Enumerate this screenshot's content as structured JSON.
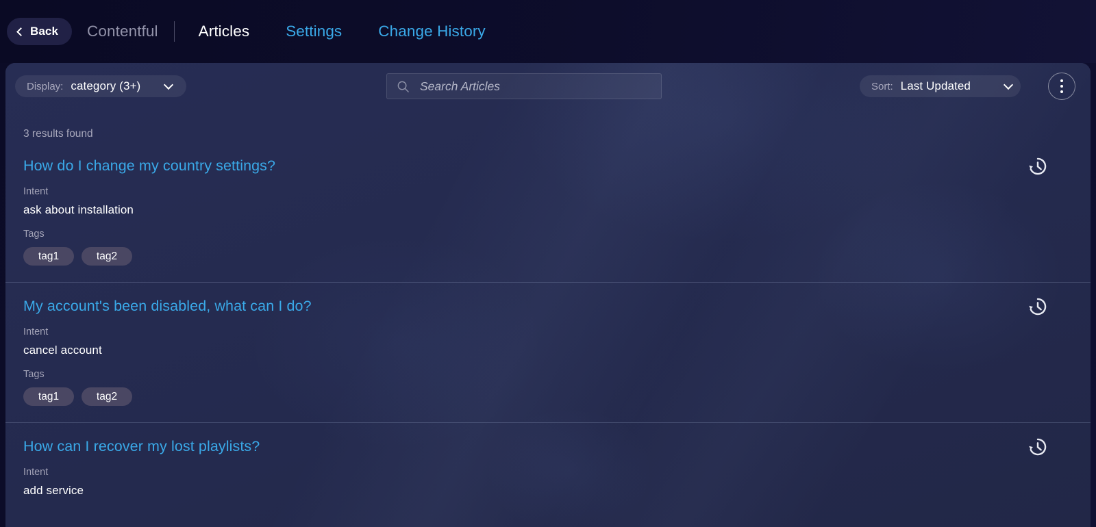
{
  "topnav": {
    "back_label": "Back",
    "back_icon": "chevron-left-icon",
    "brand": "Contentful",
    "tabs": [
      {
        "label": "Articles",
        "active": true
      },
      {
        "label": "Settings",
        "active": false
      },
      {
        "label": "Change History",
        "active": false
      }
    ]
  },
  "toolbar": {
    "display": {
      "label": "Display:",
      "value": "category (3+)",
      "icon": "chevron-down-icon"
    },
    "search": {
      "placeholder": "Search Articles",
      "value": "",
      "icon": "search-icon"
    },
    "sort": {
      "label": "Sort:",
      "value": "Last Updated",
      "icon": "chevron-down-icon"
    },
    "overflow_icon": "kebab-menu-icon"
  },
  "results": {
    "count_text": "3 results found",
    "intent_label": "Intent",
    "tags_label": "Tags",
    "history_icon": "history-restore-icon",
    "items": [
      {
        "title": "How do I change my country settings?",
        "intent": "ask about installation",
        "tags": [
          "tag1",
          "tag2"
        ]
      },
      {
        "title": "My account's been disabled, what can I do?",
        "intent": "cancel account",
        "tags": [
          "tag1",
          "tag2"
        ]
      },
      {
        "title": "How can I recover my lost playlists?",
        "intent": "add service",
        "tags": []
      }
    ]
  },
  "colors": {
    "page_background": "#0b0b26",
    "panel_background": "#252b51",
    "link_blue": "#3aa9e8",
    "muted_text": "#a2a2b6",
    "tag_background": "#4a4763",
    "back_button_background": "#212146"
  }
}
